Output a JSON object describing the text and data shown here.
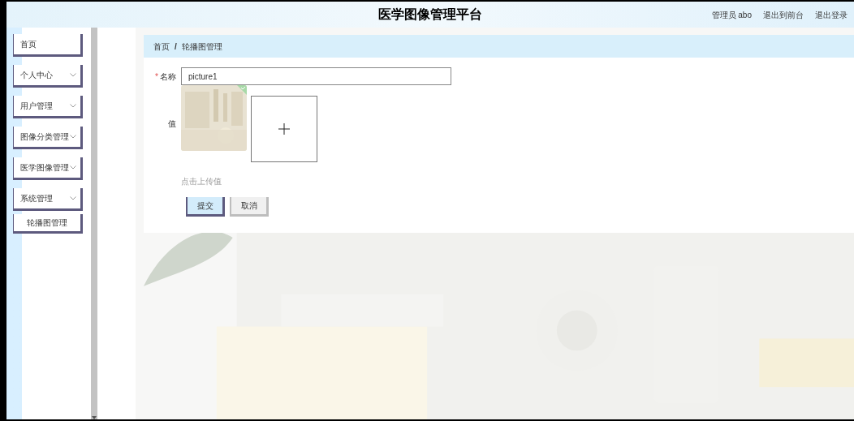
{
  "header": {
    "title": "医学图像管理平台",
    "user": "管理员 abo",
    "links": [
      "退出到前台",
      "退出登录"
    ]
  },
  "sidebar": {
    "items": [
      {
        "label": "首页",
        "kind": "link"
      },
      {
        "label": "个人中心",
        "kind": "group"
      },
      {
        "label": "用户管理",
        "kind": "group"
      },
      {
        "label": "图像分类管理",
        "kind": "group"
      },
      {
        "label": "医学图像管理",
        "kind": "group"
      },
      {
        "label": "系统管理",
        "kind": "group",
        "children": [
          {
            "label": "轮播图管理"
          }
        ]
      }
    ]
  },
  "breadcrumb": {
    "separator": "/",
    "items": [
      "首页",
      "轮播图管理"
    ]
  },
  "form": {
    "required_mark": "*",
    "fields": [
      {
        "kind": "text",
        "label": "名称",
        "required": true,
        "value": "picture1"
      },
      {
        "kind": "upload",
        "label": "值",
        "required": false,
        "uploaded": true,
        "hint": "点击上传值"
      }
    ],
    "buttons": [
      {
        "label": "提交",
        "kind": "primary"
      },
      {
        "label": "取消",
        "kind": "default"
      }
    ]
  }
}
